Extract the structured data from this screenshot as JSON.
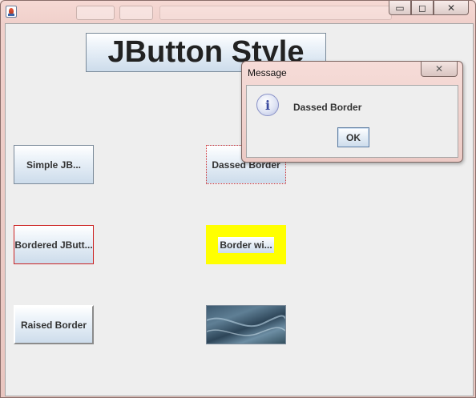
{
  "window": {
    "controls": {
      "minimize": "▭",
      "maximize": "◻",
      "close": "✕"
    }
  },
  "main": {
    "title_button": "JButton Style",
    "buttons": {
      "simple": "Simple JB...",
      "dashed": "Dassed Border",
      "bordered": "Bordered JButt...",
      "yellow": "Border wi...",
      "raised": "Raised Border"
    }
  },
  "dialog": {
    "title": "Message",
    "close": "✕",
    "icon": "i",
    "message": "Dassed Border",
    "ok": "OK"
  },
  "colors": {
    "yellow_border": "#ffff00",
    "red_border": "#cc2222"
  }
}
